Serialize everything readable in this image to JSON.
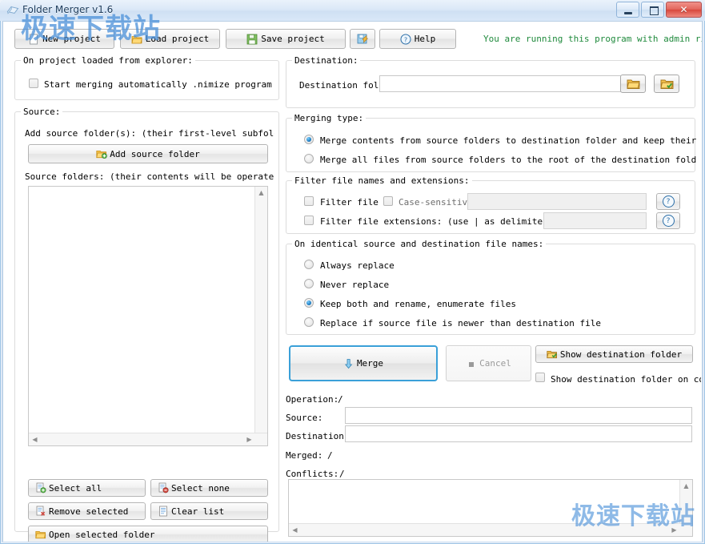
{
  "window": {
    "title": "Folder Merger v1.6",
    "icon": "folder-merge-icon",
    "minimize_label": "–",
    "maximize_label": "□",
    "close_label": "✕"
  },
  "watermark": {
    "top": "极速下载站",
    "bottom": "极速下载站",
    "color": "#4a90d9"
  },
  "toolbar": {
    "new_project": "New project",
    "load_project": "Load project",
    "save_project": "Save project",
    "save_as_icon": "save-as-icon",
    "help": "Help",
    "admin_note": "You are running this program with admin rights."
  },
  "on_project_loaded": {
    "caption": "On project loaded from explorer:",
    "checkbox_label": "Start merging automatically .nimize program window",
    "checked": false
  },
  "source": {
    "caption": "Source:",
    "add_label": "Add source folder(s): (their first-level subfolders w",
    "add_button": "Add source folder",
    "list_caption": "Source folders: (their contents will be operated on)",
    "items": [],
    "buttons": {
      "select_all": "Select all",
      "select_none": "Select none",
      "remove_selected": "Remove selected",
      "clear_list": "Clear list",
      "open_selected": "Open selected folder"
    }
  },
  "destination": {
    "caption": "Destination:",
    "field_label": "Destination fold",
    "value": "",
    "browse_icon": "open-folder-icon",
    "use_icon": "folder-check-icon"
  },
  "merging_type": {
    "caption": "Merging type:",
    "options": [
      {
        "label": "Merge contents from source folders to destination folder and keep their folder",
        "selected": true
      },
      {
        "label": "Merge all files from source folders to the root of the destination folder",
        "selected": false
      }
    ]
  },
  "filter": {
    "caption": "Filter file names and extensions:",
    "name_checkbox_label": "Filter file n",
    "name_checked": false,
    "case_sensitive_label": "Case-sensitive",
    "case_sensitive_checked": false,
    "name_value": "",
    "ext_checkbox_label": "Filter file extensions: (use | as delimiter for multiple entries)",
    "ext_checked": false,
    "ext_value": "",
    "help_icon": "question-icon"
  },
  "identical": {
    "caption": "On identical source and destination file names:",
    "options": [
      {
        "label": "Always replace",
        "selected": false
      },
      {
        "label": "Never replace",
        "selected": false
      },
      {
        "label": "Keep both and rename, enumerate files",
        "selected": true
      },
      {
        "label": "Replace if source file is newer than destination file",
        "selected": false
      }
    ]
  },
  "actions": {
    "merge": "Merge",
    "merge_icon": "merge-arrow-icon",
    "cancel": "Cancel",
    "cancel_icon": "stop-square-icon",
    "show_dest": "Show destination folder",
    "show_dest_icon": "folder-check-icon",
    "show_on_complete_label": "Show destination folder on comple",
    "show_on_complete_checked": false
  },
  "status": {
    "operation_label": "Operation:",
    "operation_value": "/",
    "source_label": "Source:",
    "source_value": "",
    "destination_label": "Destination:",
    "destination_value": "",
    "merged_label": "Merged:",
    "merged_value": "/",
    "conflicts_label": "Conflicts:",
    "conflicts_value": "/",
    "log_value": ""
  }
}
